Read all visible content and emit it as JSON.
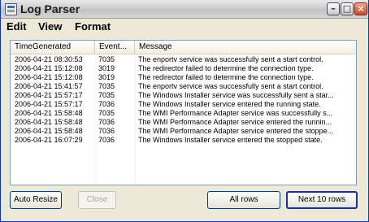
{
  "window": {
    "title": "Log Parser"
  },
  "menu": {
    "items": [
      "Edit",
      "View",
      "Format"
    ]
  },
  "table": {
    "columns": [
      "TimeGenerated",
      "Event...",
      "Message"
    ],
    "rows": [
      [
        "2006-04-21 08:30:53",
        "7035",
        "The enportv service was successfully sent a start control."
      ],
      [
        "2006-04-21 15:12:08",
        "3019",
        "The redirector failed to determine the connection type."
      ],
      [
        "2006-04-21 15:12:08",
        "3019",
        "The redirector failed to determine the connection type."
      ],
      [
        "2006-04-21 15:41:57",
        "7035",
        "The enportv service was successfully sent a start control."
      ],
      [
        "2006-04-21 15:57:17",
        "7035",
        "The Windows Installer service was successfully sent a star..."
      ],
      [
        "2006-04-21 15:57:17",
        "7036",
        "The Windows Installer service entered the running state."
      ],
      [
        "2006-04-21 15:58:48",
        "7035",
        "The WMI Performance Adapter service was successfully s..."
      ],
      [
        "2006-04-21 15:58:48",
        "7036",
        "The WMI Performance Adapter service entered the runnin..."
      ],
      [
        "2006-04-21 15:58:48",
        "7036",
        "The WMI Performance Adapter service entered the stoppe..."
      ],
      [
        "2006-04-21 16:07:29",
        "7036",
        "The Windows Installer service entered the stopped state."
      ]
    ]
  },
  "buttons": {
    "auto_resize": "Auto Resize",
    "close": "Close",
    "all_rows": "All rows",
    "next_rows": "Next 10 rows"
  },
  "icons": {
    "app": "log-parser-app-icon",
    "minimize": "minimize-icon",
    "maximize": "maximize-icon",
    "close": "close-icon"
  }
}
